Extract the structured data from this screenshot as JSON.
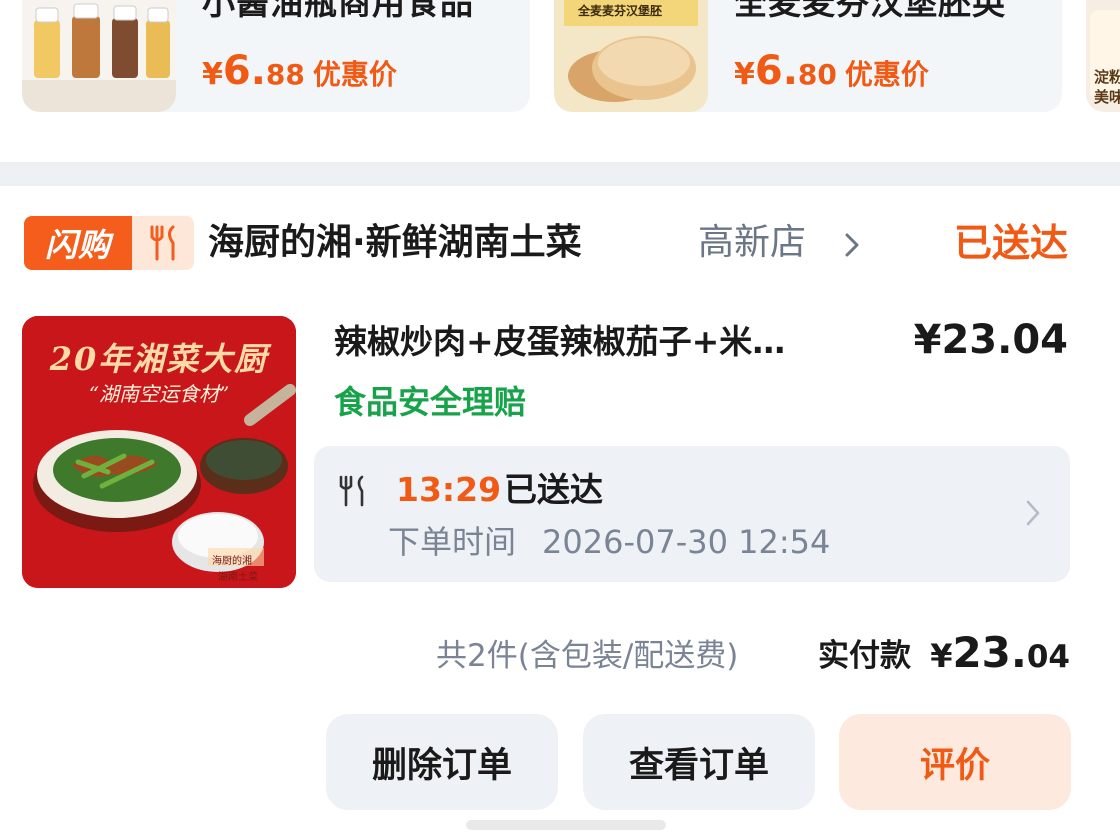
{
  "recommendations": [
    {
      "title": "小酱油瓶商用食品",
      "price_symbol": "¥",
      "price_int": "6.",
      "price_dec": "88",
      "price_tag": "优惠价",
      "thumb_icon": "oil-bottles-image"
    },
    {
      "title": "全麦麦芬汉堡胚英",
      "price_symbol": "¥",
      "price_int": "6.",
      "price_dec": "80",
      "price_tag": "优惠价",
      "thumb_icon": "muffin-bread-image",
      "thumb_label": "全麦麦芬汉堡胚"
    },
    {
      "thumb_icon": "product-image-partial",
      "thumb_label_1": "淀粉",
      "thumb_label_2": "美味"
    }
  ],
  "order": {
    "badge": "闪购",
    "badge_icon": "utensils-icon",
    "store_name": "海厨的湘·新鲜湖南土菜",
    "store_branch": "高新店",
    "status": "已送达",
    "item": {
      "image_title": "20年湘菜大厨",
      "image_subtitle": "“湖南空运食材”",
      "image_stamp_1": "海厨的湘",
      "image_stamp_2": "湖南土菜",
      "name": "辣椒炒肉+皮蛋辣椒茄子+米…",
      "price": "¥23.04",
      "safety_tag": "食品安全理赔"
    },
    "delivery": {
      "time": "13:29",
      "state": "已送达",
      "order_time_label": "下单时间",
      "order_time_value": "2026-07-30 12:54"
    },
    "summary": {
      "count_text": "共2件(含包装/配送费)",
      "paid_label": "实付款",
      "paid_symbol": "¥",
      "paid_int": "23.",
      "paid_dec": "04"
    },
    "actions": {
      "delete": "删除订单",
      "view": "查看订单",
      "review": "评价"
    }
  },
  "colors": {
    "accent": "#f05a14",
    "safety_green": "#17a34a",
    "card_bg": "#eef2f6",
    "badge_orange": "#f45d1b"
  }
}
